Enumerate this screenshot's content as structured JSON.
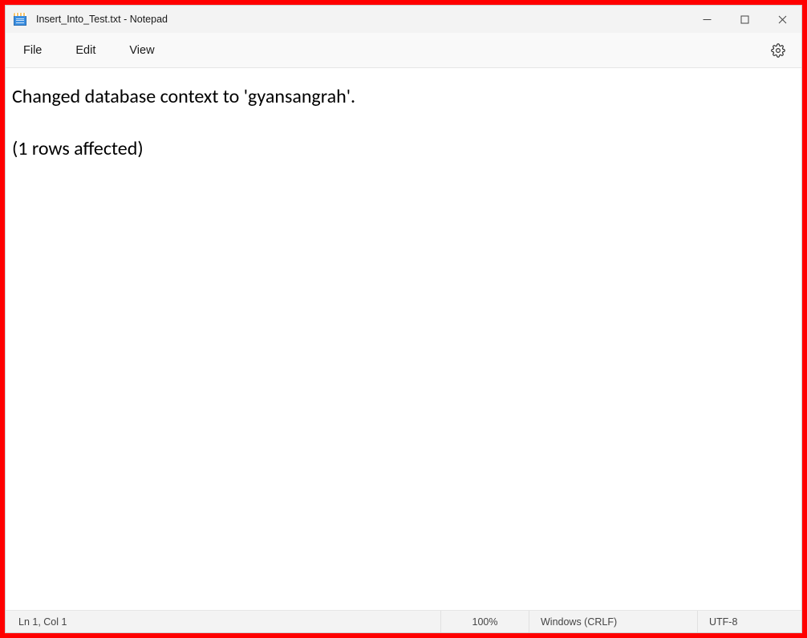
{
  "titlebar": {
    "title": "Insert_Into_Test.txt - Notepad"
  },
  "menubar": {
    "items": [
      {
        "label": "File"
      },
      {
        "label": "Edit"
      },
      {
        "label": "View"
      }
    ]
  },
  "content": {
    "text": "Changed database context to 'gyansangrah'.\n\n(1 rows affected)"
  },
  "statusbar": {
    "position": "Ln 1, Col 1",
    "zoom": "100%",
    "line_ending": "Windows (CRLF)",
    "encoding": "UTF-8"
  }
}
